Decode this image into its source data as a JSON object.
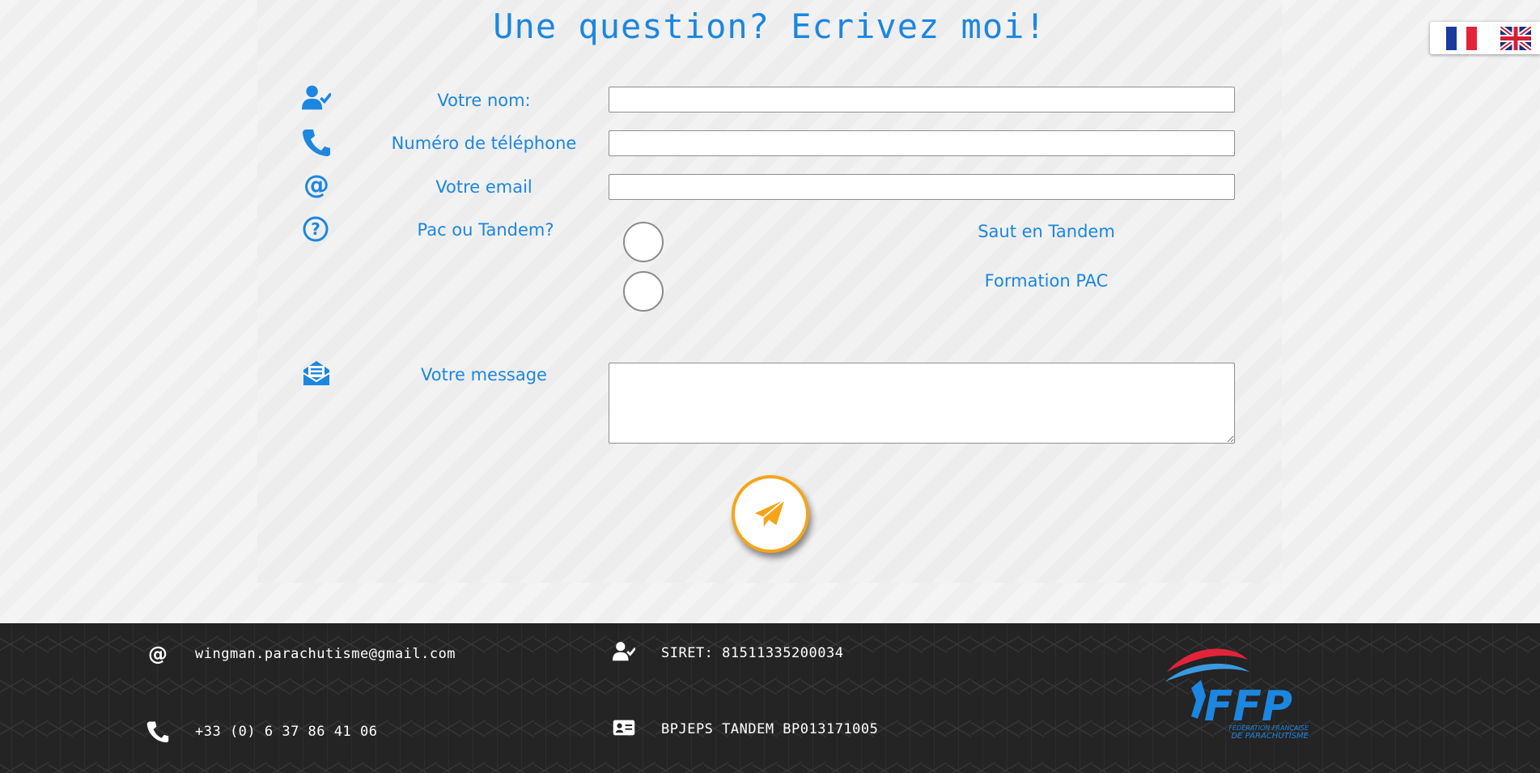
{
  "form": {
    "title": "Une question? Ecrivez moi!",
    "name_label": "Votre nom:",
    "phone_label": "Numéro de téléphone",
    "email_label": "Votre email",
    "choice_label": "Pac ou Tandem?",
    "options": [
      "Saut en Tandem",
      "Formation PAC"
    ],
    "message_label": "Votre message",
    "name_value": "",
    "phone_value": "",
    "email_value": "",
    "message_value": ""
  },
  "language_selector": {
    "languages": [
      "fr-flag-icon",
      "uk-flag-icon"
    ]
  },
  "footer": {
    "email": "wingman.parachutisme@gmail.com",
    "phone": "+33 (0) 6 37 86 41 06",
    "siret": "SIRET: 81511335200034",
    "bpjeps": "BPJEPS TANDEM BP013171005",
    "logo_text": "FFP",
    "logo_subtitle_line1": "FÉDÉRATION FRANÇAISE",
    "logo_subtitle_line2": "DE PARACHUTISME"
  },
  "colors": {
    "accent": "#1c86e0",
    "send_border": "#f5a41a",
    "footer_bg": "#242424"
  }
}
